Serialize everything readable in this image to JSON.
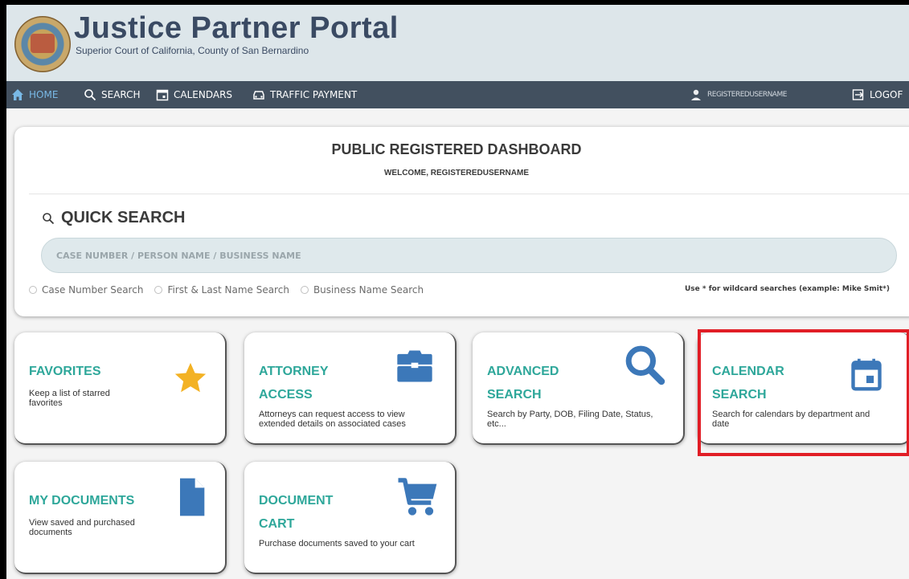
{
  "header": {
    "title": "Justice Partner Portal",
    "subtitle": "Superior Court of California, County of San Bernardino"
  },
  "nav": {
    "home": "HOME",
    "search": "SEARCH",
    "calendars": "CALENDARS",
    "traffic": "TRAFFIC PAYMENT",
    "user": "REGISTEREDUSERNAME",
    "logoff": "LOGOF"
  },
  "dashboard": {
    "title": "PUBLIC REGISTERED DASHBOARD",
    "welcome": "WELCOME, REGISTEREDUSERNAME"
  },
  "quick_search": {
    "title": "QUICK SEARCH",
    "placeholder": "CASE NUMBER / PERSON NAME / BUSINESS NAME",
    "options": [
      "Case Number Search",
      "First & Last Name Search",
      "Business Name Search"
    ],
    "hint": "Use * for wildcard searches (example: Mike Smit*)"
  },
  "cards": {
    "favorites": {
      "title": "FAVORITES",
      "desc": "Keep a list of starred favorites",
      "icon": "star-icon"
    },
    "attorney": {
      "title": "ATTORNEY ACCESS",
      "desc": "Attorneys can request access to view extended details on associated cases",
      "icon": "briefcase-icon"
    },
    "advanced": {
      "title": "ADVANCED SEARCH",
      "desc": "Search by Party, DOB, Filing Date, Status, etc...",
      "icon": "magnifier-icon"
    },
    "calendar": {
      "title": "CALENDAR SEARCH",
      "desc": "Search for calendars by department and date",
      "icon": "calendar-icon"
    },
    "mydocs": {
      "title": "MY DOCUMENTS",
      "desc": "View saved and purchased documents",
      "icon": "document-icon"
    },
    "cart": {
      "title": "DOCUMENT CART",
      "desc": "Purchase documents saved to your cart",
      "icon": "cart-icon"
    }
  },
  "colors": {
    "accent": "#2ea79a",
    "icon": "#3c78b9",
    "star": "#f3b224",
    "nav": "#42505f",
    "highlight": "#e11e26"
  }
}
